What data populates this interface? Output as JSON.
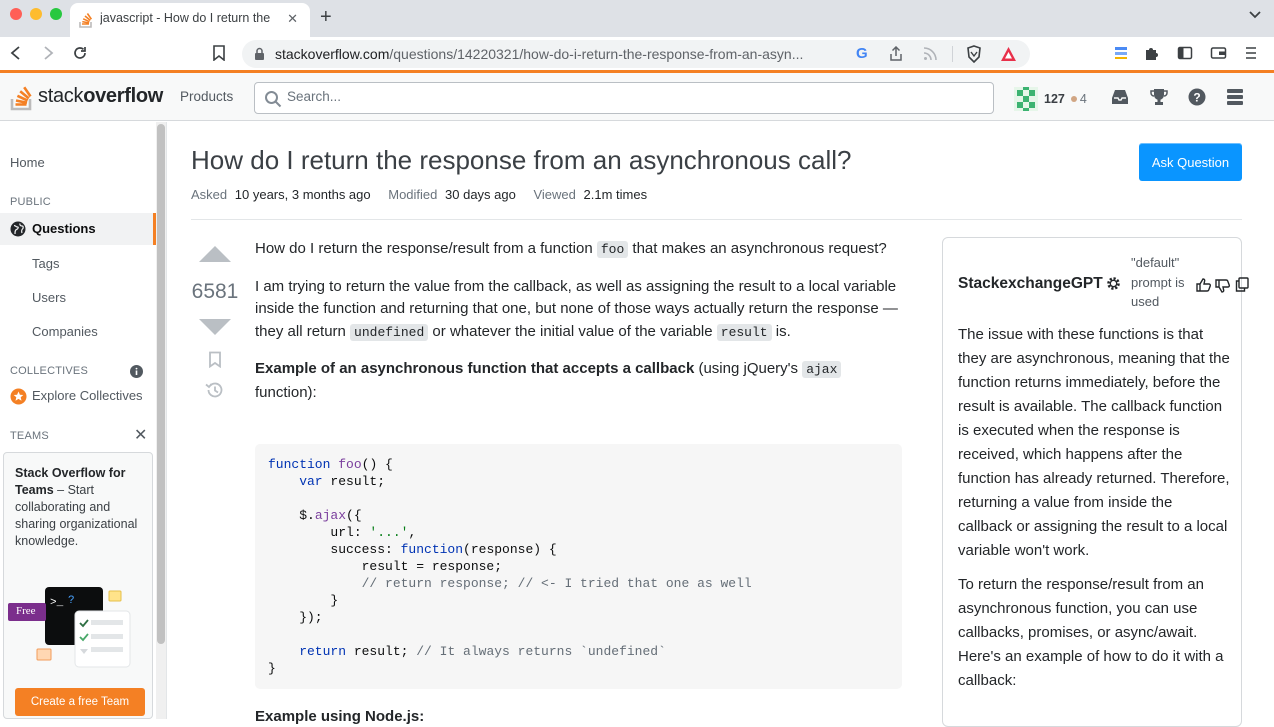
{
  "browser": {
    "tab_title": "javascript - How do I return the",
    "url_host": "stackoverflow.com",
    "url_path": "/questions/14220321/how-do-i-return-the-response-from-an-asyn..."
  },
  "header": {
    "logo_light": "stack",
    "logo_bold": "overflow",
    "products": "Products",
    "search_placeholder": "Search...",
    "reputation": "127",
    "bronze_badges": "4"
  },
  "sidebar": {
    "home": "Home",
    "public_label": "PUBLIC",
    "questions": "Questions",
    "tags": "Tags",
    "users": "Users",
    "companies": "Companies",
    "collectives_label": "COLLECTIVES",
    "explore_collectives": "Explore Collectives",
    "teams_label": "TEAMS",
    "teams_heading": "Stack Overflow for Teams",
    "teams_body": " – Start collaborating and sharing organizational knowledge.",
    "free_tag": "Free",
    "create_team": "Create a free Team"
  },
  "question": {
    "title": "How do I return the response from an asynchronous call?",
    "ask_button": "Ask Question",
    "asked_label": "Asked",
    "asked_value": "10 years, 3 months ago",
    "modified_label": "Modified",
    "modified_value": "30 days ago",
    "viewed_label": "Viewed",
    "viewed_value": "2.1m times",
    "votes": "6581",
    "p1_a": "How do I return the response/result from a function ",
    "p1_code": "foo",
    "p1_b": " that makes an asynchronous request?",
    "p2_a": "I am trying to return the value from the callback, as well as assigning the result to a local variable inside the function and returning that one, but none of those ways actually return the response — they all return ",
    "p2_code1": "undefined",
    "p2_b": " or whatever the initial value of the variable ",
    "p2_code2": "result",
    "p2_c": " is.",
    "p3_bold": "Example of an asynchronous function that accepts a callback",
    "p3_a": " (using jQuery's ",
    "p3_code": "ajax",
    "p3_b": " function):",
    "next_heading": "Example using Node.js:"
  },
  "code": {
    "l1_kw": "function",
    "l1_fn": " foo",
    "l1_rest": "() {",
    "l2_kw": "    var",
    "l2_rest": " result;",
    "l4_a": "    $.",
    "l4_fn": "ajax",
    "l4_rest": "({",
    "l5_a": "        url: ",
    "l5_str": "'...'",
    "l5_rest": ",",
    "l6_a": "        success: ",
    "l6_kw": "function",
    "l6_rest": "(response) {",
    "l7": "            result = response;",
    "l8_cm": "            // return response; // <- I tried that one as well",
    "l9": "        }",
    "l10": "    });",
    "l12_kw": "    return",
    "l12_a": " result; ",
    "l12_cm": "// It always returns `undefined`",
    "l13": "}"
  },
  "gpt": {
    "title": "StackexchangeGPT",
    "note": "\"default\" prompt is used",
    "p1": "The issue with these functions is that they are asynchronous, meaning that the function returns immediately, before the result is available. The callback function is executed when the response is received, which happens after the function has already returned. Therefore, returning a value from inside the callback or assigning the result to a local variable won't work.",
    "p2": "To return the response/result from an asynchronous function, you can use callbacks, promises, or async/await. Here's an example of how to do it with a callback:"
  },
  "colors": {
    "accent": "#f48024",
    "primary_button": "#0a95ff"
  }
}
